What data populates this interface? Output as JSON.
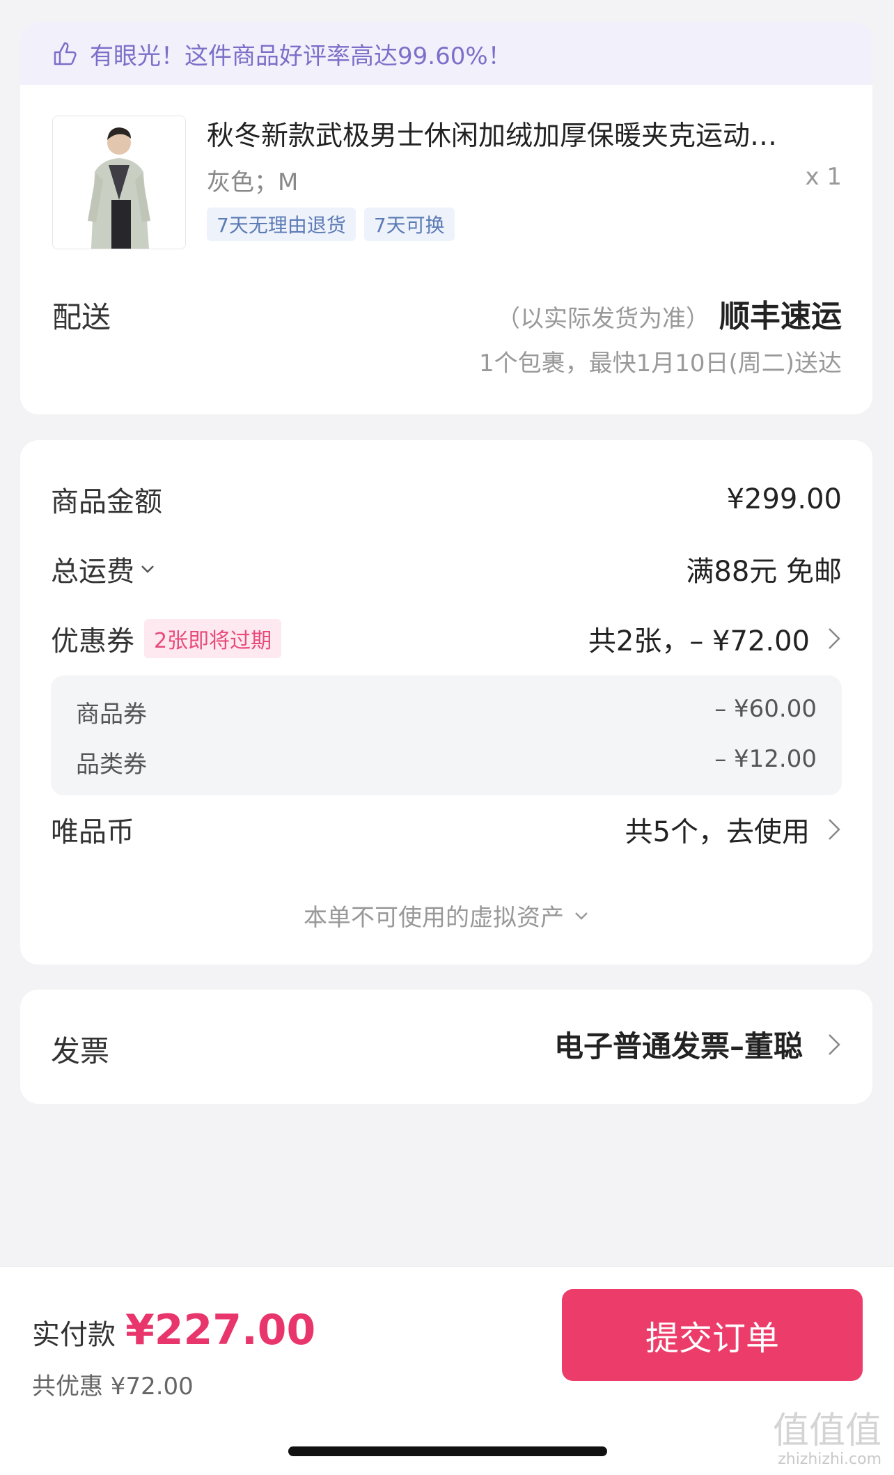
{
  "banner": {
    "text": "有眼光！这件商品好评率高达99.60%！",
    "icon": "thumbs-up-icon"
  },
  "product": {
    "title": "秋冬新款武极男士休闲加绒加厚保暖夹克运动…",
    "spec": "灰色；M",
    "qty": "x 1",
    "tags": [
      "7天无理由退货",
      "7天可换"
    ]
  },
  "shipping": {
    "label": "配送",
    "note": "（以实际发货为准）",
    "carrier": "顺丰速运",
    "eta": "1个包裹，最快1月10日(周二)送达"
  },
  "price": {
    "goods_label": "商品金额",
    "goods_value": "¥299.00",
    "freight_label": "总运费",
    "freight_value": "满88元 免邮",
    "coupon_label": "优惠券",
    "coupon_badge": "2张即将过期",
    "coupon_value": "共2张，– ¥72.00",
    "coupon_items": [
      {
        "name": "商品券",
        "value": "– ¥60.00"
      },
      {
        "name": "品类券",
        "value": "– ¥12.00"
      }
    ],
    "coin_label": "唯品币",
    "coin_value": "共5个，去使用",
    "virtual_assets": "本单不可使用的虚拟资产"
  },
  "invoice": {
    "label": "发票",
    "value": "电子普通发票–董聪"
  },
  "footer": {
    "pay_label": "实付款",
    "pay_amount": "¥227.00",
    "discount": "共优惠 ¥72.00",
    "submit": "提交订单"
  },
  "watermark": {
    "big": "值值值",
    "small": "zhizhizhi.com"
  },
  "colors": {
    "accent": "#ec3c6a",
    "price": "#e8356c",
    "banner_text": "#7c6fc9",
    "tag_text": "#5c7bb5"
  }
}
